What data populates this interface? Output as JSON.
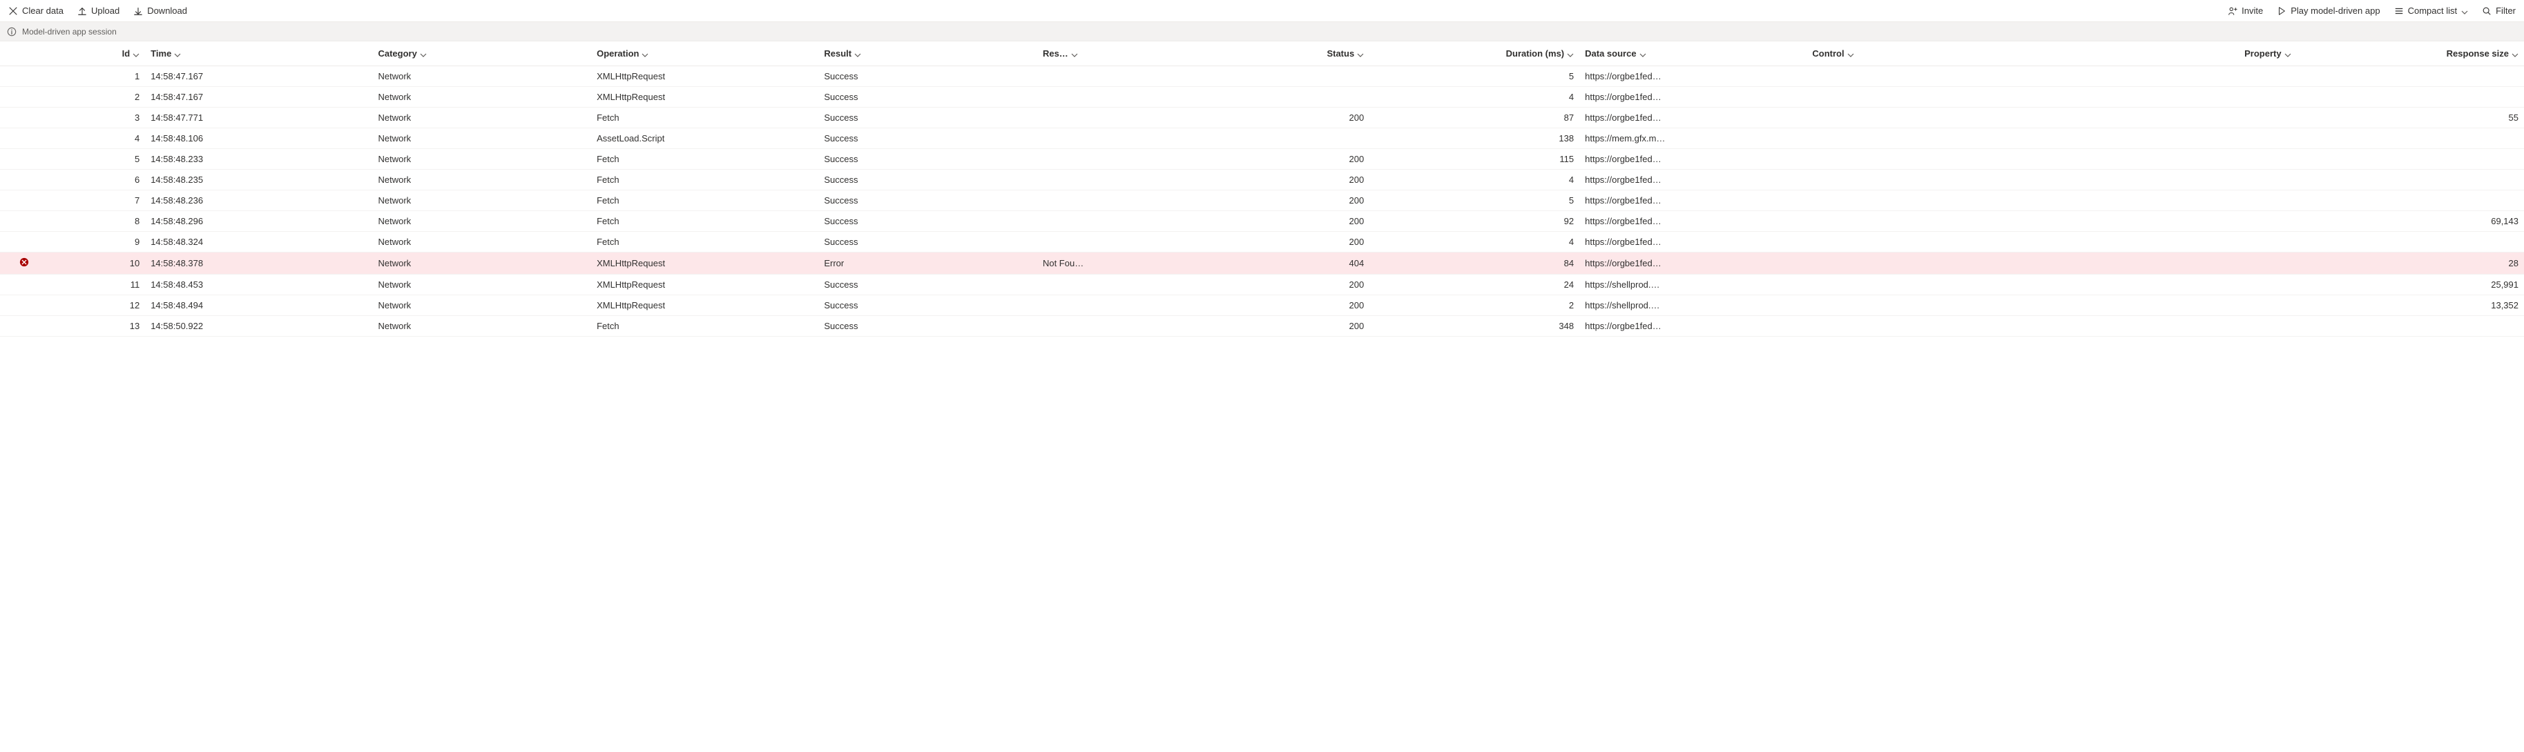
{
  "toolbar": {
    "left": {
      "clear_data": "Clear data",
      "upload": "Upload",
      "download": "Download"
    },
    "right": {
      "invite": "Invite",
      "play": "Play model-driven app",
      "compact_list": "Compact list",
      "filter": "Filter"
    }
  },
  "session_label": "Model-driven app session",
  "columns": {
    "id": "Id",
    "time": "Time",
    "category": "Category",
    "operation": "Operation",
    "result": "Result",
    "reason": "Res…",
    "status": "Status",
    "duration": "Duration (ms)",
    "data_source": "Data source",
    "control": "Control",
    "property": "Property",
    "response_size": "Response size"
  },
  "rows": [
    {
      "id": "1",
      "time": "14:58:47.167",
      "category": "Network",
      "operation": "XMLHttpRequest",
      "result": "Success",
      "reason": "",
      "status": "",
      "duration": "5",
      "data_source": "https://orgbe1fed…",
      "control": "",
      "property": "",
      "response_size": "",
      "error": false
    },
    {
      "id": "2",
      "time": "14:58:47.167",
      "category": "Network",
      "operation": "XMLHttpRequest",
      "result": "Success",
      "reason": "",
      "status": "",
      "duration": "4",
      "data_source": "https://orgbe1fed…",
      "control": "",
      "property": "",
      "response_size": "",
      "error": false
    },
    {
      "id": "3",
      "time": "14:58:47.771",
      "category": "Network",
      "operation": "Fetch",
      "result": "Success",
      "reason": "",
      "status": "200",
      "duration": "87",
      "data_source": "https://orgbe1fed…",
      "control": "",
      "property": "",
      "response_size": "55",
      "error": false
    },
    {
      "id": "4",
      "time": "14:58:48.106",
      "category": "Network",
      "operation": "AssetLoad.Script",
      "result": "Success",
      "reason": "",
      "status": "",
      "duration": "138",
      "data_source": "https://mem.gfx.m…",
      "control": "",
      "property": "",
      "response_size": "",
      "error": false
    },
    {
      "id": "5",
      "time": "14:58:48.233",
      "category": "Network",
      "operation": "Fetch",
      "result": "Success",
      "reason": "",
      "status": "200",
      "duration": "115",
      "data_source": "https://orgbe1fed…",
      "control": "",
      "property": "",
      "response_size": "",
      "error": false
    },
    {
      "id": "6",
      "time": "14:58:48.235",
      "category": "Network",
      "operation": "Fetch",
      "result": "Success",
      "reason": "",
      "status": "200",
      "duration": "4",
      "data_source": "https://orgbe1fed…",
      "control": "",
      "property": "",
      "response_size": "",
      "error": false
    },
    {
      "id": "7",
      "time": "14:58:48.236",
      "category": "Network",
      "operation": "Fetch",
      "result": "Success",
      "reason": "",
      "status": "200",
      "duration": "5",
      "data_source": "https://orgbe1fed…",
      "control": "",
      "property": "",
      "response_size": "",
      "error": false
    },
    {
      "id": "8",
      "time": "14:58:48.296",
      "category": "Network",
      "operation": "Fetch",
      "result": "Success",
      "reason": "",
      "status": "200",
      "duration": "92",
      "data_source": "https://orgbe1fed…",
      "control": "",
      "property": "",
      "response_size": "69,143",
      "error": false
    },
    {
      "id": "9",
      "time": "14:58:48.324",
      "category": "Network",
      "operation": "Fetch",
      "result": "Success",
      "reason": "",
      "status": "200",
      "duration": "4",
      "data_source": "https://orgbe1fed…",
      "control": "",
      "property": "",
      "response_size": "",
      "error": false
    },
    {
      "id": "10",
      "time": "14:58:48.378",
      "category": "Network",
      "operation": "XMLHttpRequest",
      "result": "Error",
      "reason": "Not Fou…",
      "status": "404",
      "duration": "84",
      "data_source": "https://orgbe1fed…",
      "control": "",
      "property": "",
      "response_size": "28",
      "error": true
    },
    {
      "id": "11",
      "time": "14:58:48.453",
      "category": "Network",
      "operation": "XMLHttpRequest",
      "result": "Success",
      "reason": "",
      "status": "200",
      "duration": "24",
      "data_source": "https://shellprod.…",
      "control": "",
      "property": "",
      "response_size": "25,991",
      "error": false
    },
    {
      "id": "12",
      "time": "14:58:48.494",
      "category": "Network",
      "operation": "XMLHttpRequest",
      "result": "Success",
      "reason": "",
      "status": "200",
      "duration": "2",
      "data_source": "https://shellprod.…",
      "control": "",
      "property": "",
      "response_size": "13,352",
      "error": false
    },
    {
      "id": "13",
      "time": "14:58:50.922",
      "category": "Network",
      "operation": "Fetch",
      "result": "Success",
      "reason": "",
      "status": "200",
      "duration": "348",
      "data_source": "https://orgbe1fed…",
      "control": "",
      "property": "",
      "response_size": "",
      "error": false
    }
  ]
}
